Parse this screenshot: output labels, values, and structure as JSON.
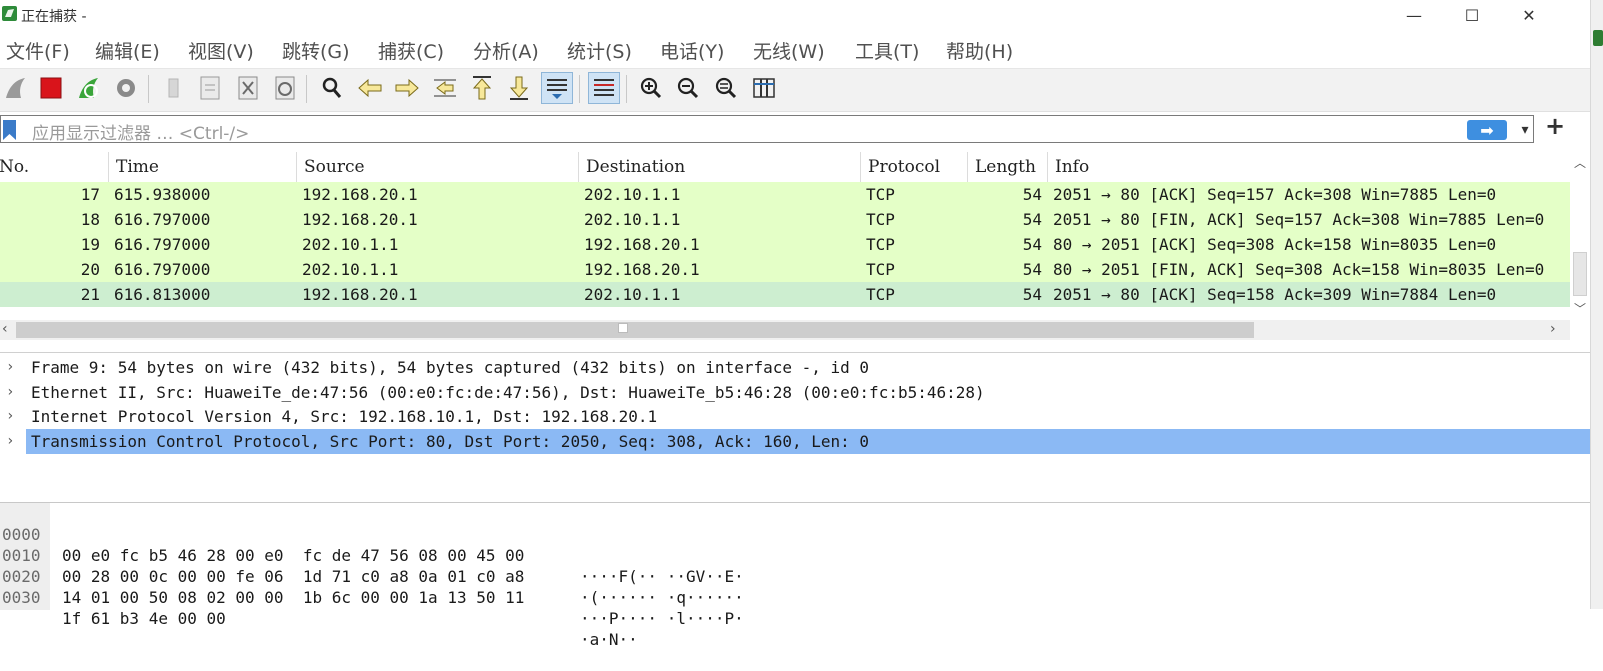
{
  "window": {
    "title": "正在捕获 -",
    "minimize_glyph": "—",
    "maximize_glyph": "☐",
    "close_glyph": "✕"
  },
  "menu": [
    "文件(F)",
    "编辑(E)",
    "视图(V)",
    "跳转(G)",
    "捕获(C)",
    "分析(A)",
    "统计(S)",
    "电话(Y)",
    "无线(W)",
    "工具(T)",
    "帮助(H)"
  ],
  "toolbar": {
    "icons": [
      "shark-fin-start-icon",
      "stop-capture-icon",
      "restart-capture-icon",
      "capture-options-gear-icon",
      "open-file-icon",
      "save-file-icon",
      "close-file-icon",
      "reload-file-icon",
      "find-packet-icon",
      "go-back-icon",
      "go-forward-icon",
      "go-to-packet-icon",
      "go-first-packet-icon",
      "go-last-packet-icon",
      "auto-scroll-icon",
      "colorize-icon",
      "zoom-in-icon",
      "zoom-out-icon",
      "normal-size-icon",
      "resize-columns-icon"
    ],
    "active": [
      "auto-scroll-icon",
      "colorize-icon"
    ]
  },
  "filter": {
    "placeholder": "应用显示过滤器 … <Ctrl-/>",
    "apply_glyph": "➡",
    "dropdown_glyph": "▾",
    "add_glyph": "+"
  },
  "packet_list": {
    "columns": [
      "No.",
      "Time",
      "Source",
      "Destination",
      "Protocol",
      "Length",
      "Info"
    ],
    "rows": [
      {
        "no": "17",
        "time": "615.938000",
        "src": "192.168.20.1",
        "dst": "202.10.1.1",
        "proto": "TCP",
        "len": "54",
        "info": "2051 → 80 [ACK] Seq=157 Ack=308 Win=7885 Len=0"
      },
      {
        "no": "18",
        "time": "616.797000",
        "src": "192.168.20.1",
        "dst": "202.10.1.1",
        "proto": "TCP",
        "len": "54",
        "info": "2051 → 80 [FIN, ACK] Seq=157 Ack=308 Win=7885 Len=0"
      },
      {
        "no": "19",
        "time": "616.797000",
        "src": "202.10.1.1",
        "dst": "192.168.20.1",
        "proto": "TCP",
        "len": "54",
        "info": "80 → 2051 [ACK] Seq=308 Ack=158 Win=8035 Len=0"
      },
      {
        "no": "20",
        "time": "616.797000",
        "src": "202.10.1.1",
        "dst": "192.168.20.1",
        "proto": "TCP",
        "len": "54",
        "info": "80 → 2051 [FIN, ACK] Seq=308 Ack=158 Win=8035 Len=0"
      },
      {
        "no": "21",
        "time": "616.813000",
        "src": "192.168.20.1",
        "dst": "202.10.1.1",
        "proto": "TCP",
        "len": "54",
        "info": "2051 → 80 [ACK] Seq=158 Ack=309 Win=7884 Len=0"
      }
    ],
    "row_color": "#e4ffc7",
    "selected_row_color": "#cdeed0"
  },
  "details": [
    "Frame 9: 54 bytes on wire (432 bits), 54 bytes captured (432 bits) on interface -, id 0",
    "Ethernet II, Src: HuaweiTe_de:47:56 (00:e0:fc:de:47:56), Dst: HuaweiTe_b5:46:28 (00:e0:fc:b5:46:28)",
    "Internet Protocol Version 4, Src: 192.168.10.1, Dst: 192.168.20.1",
    "Transmission Control Protocol, Src Port: 80, Dst Port: 2050, Seq: 308, Ack: 160, Len: 0"
  ],
  "details_selected_color": "#8bb9f4",
  "bytes": [
    {
      "off": "0000",
      "hex": "00 e0 fc b5 46 28 00 e0  fc de 47 56 08 00 45 00",
      "ascii": "····F(·· ··GV··E·"
    },
    {
      "off": "0010",
      "hex": "00 28 00 0c 00 00 fe 06  1d 71 c0 a8 0a 01 c0 a8",
      "ascii": "·(······ ·q······"
    },
    {
      "off": "0020",
      "hex": "14 01 00 50 08 02 00 00  1b 6c 00 00 1a 13 50 11",
      "ascii": "···P···· ·l····P·"
    },
    {
      "off": "0030",
      "hex": "1f 61 b3 4e 00 00",
      "ascii": "·a·N··"
    }
  ]
}
